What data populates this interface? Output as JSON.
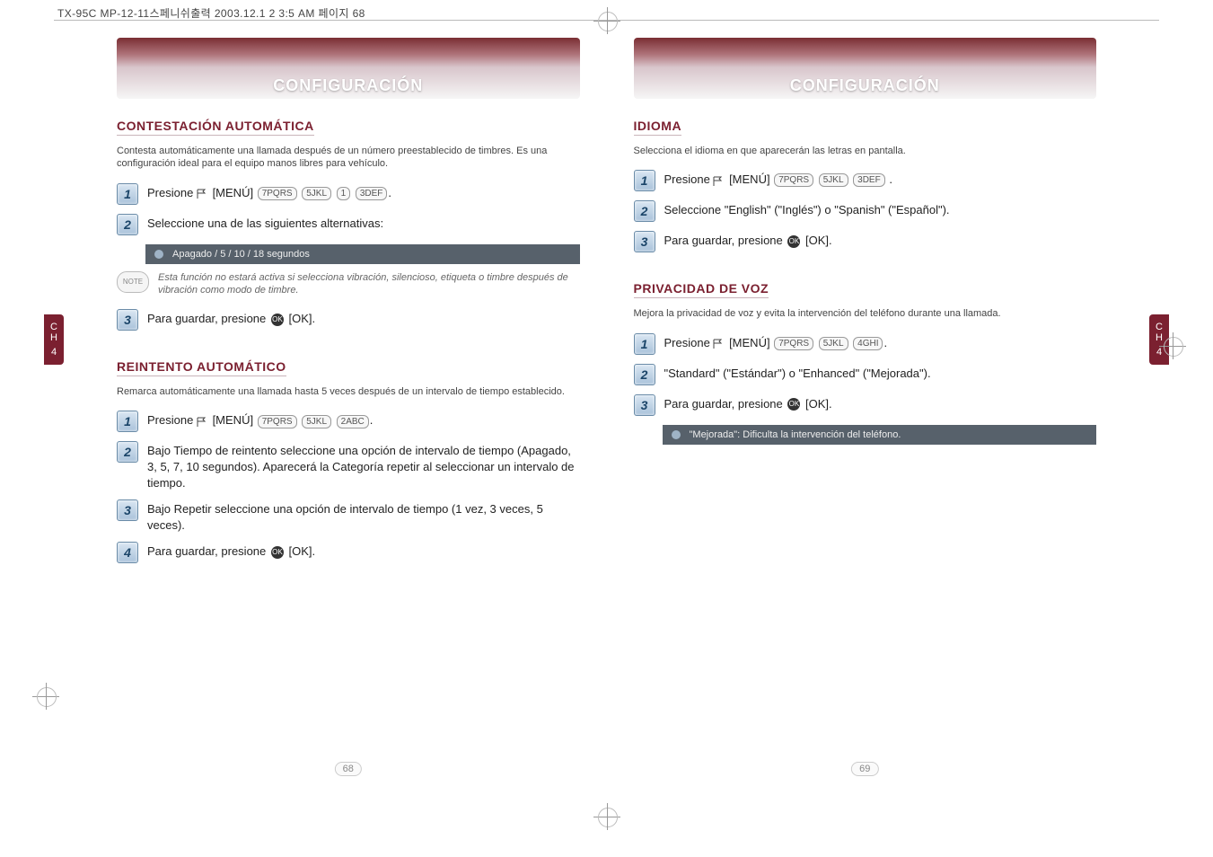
{
  "crop_info": "TX-95C MP-12-11스페니쉬출력  2003.12.1 2 3:5 AM  페이지 68",
  "side_tab": {
    "ch": "C\nH",
    "num": "4"
  },
  "left": {
    "banner": "CONFIGURACIÓN",
    "sec1": {
      "title": "CONTESTACIÓN AUTOMÁTICA",
      "desc": "Contesta automáticamente una llamada después de un número preestablecido de timbres. Es una configuración ideal para el equipo manos libres para vehículo.",
      "steps": {
        "s1": "Presione",
        "s1_menu": "[MENÚ]",
        "s1_keys": [
          "7PQRS",
          "5JKL",
          "1",
          "3DEF"
        ],
        "s2": "Seleccione una de las siguientes alternativas:",
        "dark": "Apagado / 5 / 10 / 18 segundos",
        "note_label": "NOTE",
        "note": "Esta función no estará activa si selecciona vibración, silencioso, etiqueta o timbre después de vibración como modo de timbre.",
        "s3_a": "Para guardar, presione",
        "s3_b": "[OK]."
      }
    },
    "sec2": {
      "title": "REINTENTO AUTOMÁTICO",
      "desc": "Remarca automáticamente una llamada hasta 5 veces después de un intervalo de tiempo establecido.",
      "steps": {
        "s1": "Presione",
        "s1_menu": "[MENÚ]",
        "s1_keys": [
          "7PQRS",
          "5JKL",
          "2ABC"
        ],
        "s2": "Bajo Tiempo de reintento seleccione una opción de intervalo de tiempo (Apagado, 3, 5, 7, 10 segundos). Aparecerá la Categoría repetir al seleccionar un intervalo de tiempo.",
        "s3": "Bajo Repetir seleccione una opción de intervalo de tiempo (1 vez, 3 veces, 5 veces).",
        "s4_a": "Para guardar, presione",
        "s4_b": "[OK]."
      }
    },
    "page_number": "68"
  },
  "right": {
    "banner": "CONFIGURACIÓN",
    "sec1": {
      "title": "IDIOMA",
      "desc": "Selecciona el idioma en que aparecerán las letras en pantalla.",
      "steps": {
        "s1": "Presione",
        "s1_menu": "[MENÚ]",
        "s1_keys": [
          "7PQRS",
          "5JKL",
          "3DEF"
        ],
        "s2": "Seleccione \"English\" (\"Inglés\") o \"Spanish\" (\"Español\").",
        "s3_a": "Para guardar, presione",
        "s3_b": "[OK]."
      }
    },
    "sec2": {
      "title": "PRIVACIDAD DE VOZ",
      "desc": "Mejora la privacidad de voz y evita la intervención del teléfono durante una llamada.",
      "steps": {
        "s1": "Presione",
        "s1_menu": "[MENÚ]",
        "s1_keys": [
          "7PQRS",
          "5JKL",
          "4GHI"
        ],
        "s2": "\"Standard\" (\"Estándar\") o \"Enhanced\" (\"Mejorada\").",
        "s3_a": "Para guardar, presione",
        "s3_b": "[OK].",
        "dark": "\"Mejorada\": Dificulta la intervención del teléfono."
      }
    },
    "page_number": "69"
  }
}
